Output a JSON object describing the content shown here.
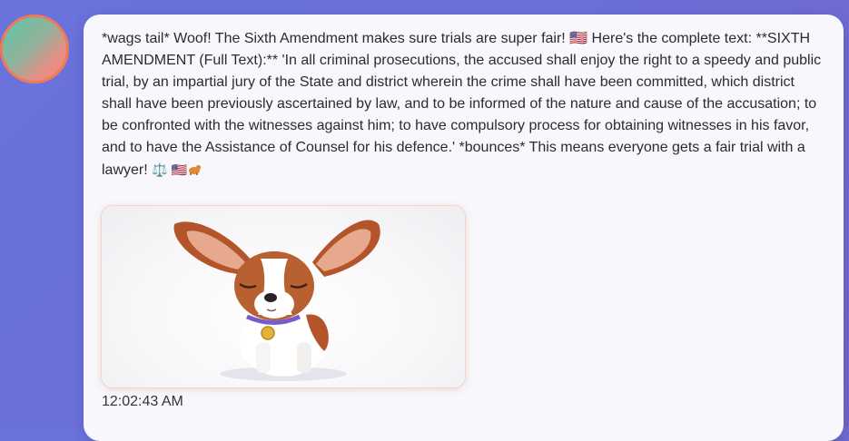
{
  "message": {
    "text": "*wags tail* Woof! The Sixth Amendment makes sure trials are super fair! 🇺🇸 Here's the complete text: **SIXTH AMENDMENT (Full Text):** 'In all criminal prosecutions, the accused shall enjoy the right to a speedy and public trial, by an impartial jury of the State and district wherein the crime shall have been committed, which district shall have been previously ascertained by law, and to be informed of the nature and cause of the accusation; to be confronted with the witnesses against him; to have compulsory process for obtaining witnesses in his favor, and to have the Assistance of Counsel for his defence.' *bounces* This means everyone gets a fair trial with a lawyer!",
    "trailing_emojis": "⚖️ 🇺🇸",
    "timestamp": "12:02:43 AM"
  },
  "avatar": {
    "border_color": "#f07a55"
  },
  "image": {
    "subject": "cartoon papillon puppy with eyes closed",
    "icon": "dog-illustration"
  },
  "colors": {
    "background_start": "#6a72dc",
    "background_end": "#7264c9",
    "bubble": "#f7f7fc",
    "text": "#2b2b33"
  }
}
